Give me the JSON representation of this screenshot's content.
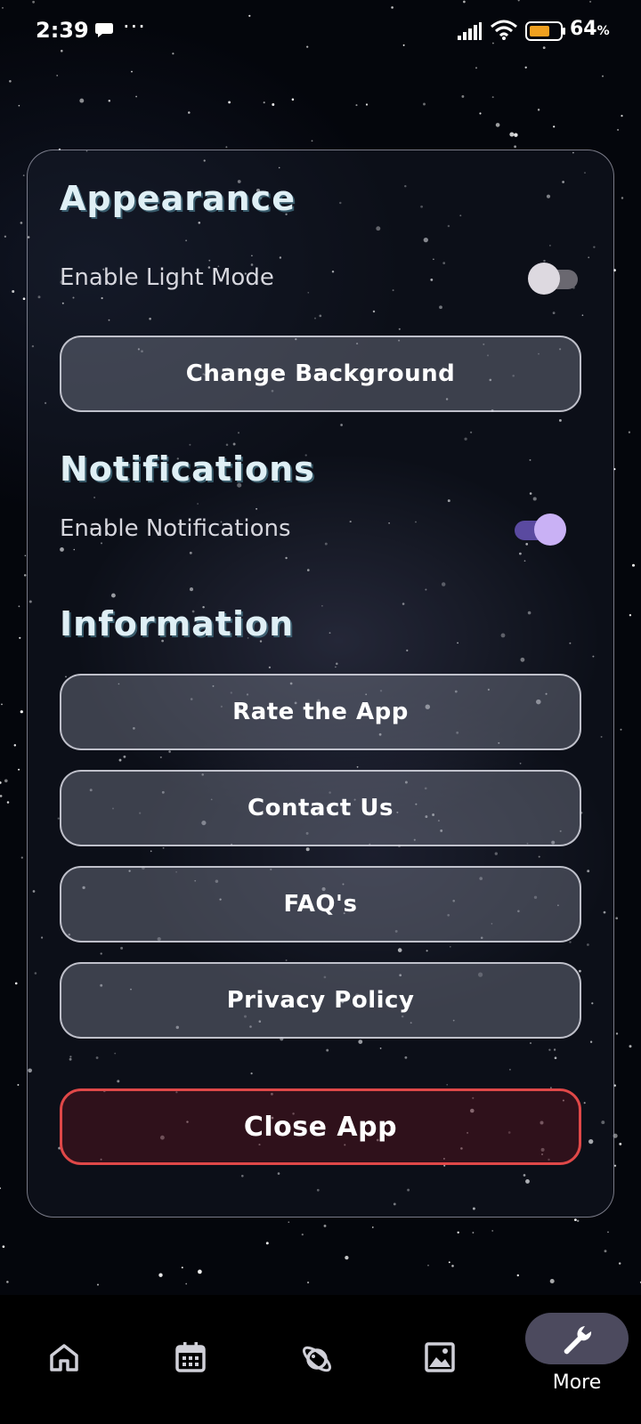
{
  "status_bar": {
    "time": "2:39",
    "more_indicator": "···",
    "battery_percent": "64",
    "battery_unit": "%",
    "icons": [
      "message-icon",
      "signal-icon",
      "wifi-icon",
      "battery-icon"
    ]
  },
  "appearance": {
    "title": "Appearance",
    "light_mode_label": "Enable Light Mode",
    "light_mode_enabled": false,
    "change_background_label": "Change Background"
  },
  "notifications": {
    "title": "Notifications",
    "enable_label": "Enable Notifications",
    "enabled": true
  },
  "information": {
    "title": "Information",
    "buttons": [
      {
        "label": "Rate the App"
      },
      {
        "label": "Contact Us"
      },
      {
        "label": "FAQ's"
      },
      {
        "label": "Privacy Policy"
      }
    ]
  },
  "close_app_label": "Close App",
  "bottom_nav": {
    "items": [
      {
        "icon": "home-icon"
      },
      {
        "icon": "calendar-icon"
      },
      {
        "icon": "planet-icon"
      },
      {
        "icon": "image-icon"
      },
      {
        "icon": "wrench-icon",
        "label": "More",
        "active": true
      }
    ]
  },
  "colors": {
    "accent_toggle_on": "#c9b1f5",
    "danger_border": "#e04848",
    "title_color": "#dfeff5"
  }
}
